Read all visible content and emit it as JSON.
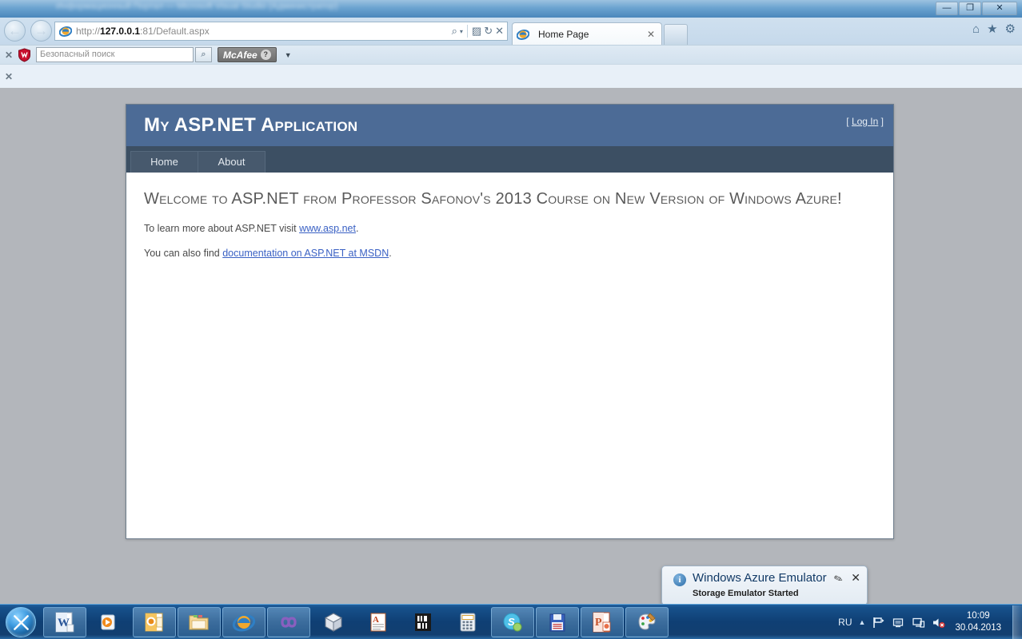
{
  "desktop": {
    "blurred_window_title": "Информационный Портал — Microsoft Visual Studio (Администратор)"
  },
  "window_controls": {
    "minimize": "—",
    "restore": "❐",
    "close": "✕"
  },
  "browser": {
    "back_label": "←",
    "forward_label": "→",
    "address": {
      "scheme": "http://",
      "host": "127.0.0.1",
      "rest": ":81/Default.aspx",
      "full": "http://127.0.0.1:81/Default.aspx"
    },
    "address_icons": {
      "search": "⌕",
      "dropdown": "▾",
      "compatibility": "▨",
      "refresh": "↻",
      "stop": "✕"
    },
    "tabs": [
      {
        "title": "Home Page",
        "close": "✕",
        "active": true
      }
    ],
    "new_tab_label": "",
    "command_icons": {
      "home": "⌂",
      "favorites": "★",
      "tools": "⚙"
    }
  },
  "mcafee_toolbar": {
    "close_label": "✕",
    "search_placeholder": "Безопасный поиск",
    "search_value": "",
    "search_button": "⌕",
    "brand": "McAfee",
    "help_label": "?",
    "caret": "▼"
  },
  "second_toolbar": {
    "close_label": "✕"
  },
  "page": {
    "site_title": "My ASP.NET Application",
    "login": {
      "prefix": "[ ",
      "link": "Log In",
      "suffix": " ]"
    },
    "nav_tabs": [
      {
        "label": "Home",
        "active": true
      },
      {
        "label": "About",
        "active": false
      }
    ],
    "heading": "Welcome to ASP.NET from Professor Safonov's 2013 Course on New Version of Windows Azure!",
    "paragraph1": {
      "before": "To learn more about ASP.NET visit ",
      "link": "www.asp.net",
      "after": "."
    },
    "paragraph2": {
      "before": "You can also find ",
      "link": "documentation on ASP.NET at MSDN",
      "after": "."
    }
  },
  "notification": {
    "info_icon": "i",
    "title": "Windows Azure Emulator",
    "subtitle": "Storage Emulator Started",
    "pin_icon": "✎",
    "close_icon": "✕"
  },
  "taskbar": {
    "start_label": "Start",
    "items": [
      {
        "name": "word",
        "label": "W"
      },
      {
        "name": "media-player",
        "label": "▶"
      },
      {
        "name": "outlook",
        "label": "O"
      },
      {
        "name": "explorer",
        "label": ""
      },
      {
        "name": "internet-explorer",
        "label": "e"
      },
      {
        "name": "visual-studio",
        "label": "∞"
      },
      {
        "name": "cube-app",
        "label": ""
      },
      {
        "name": "document-app",
        "label": "A"
      },
      {
        "name": "barcode-app",
        "label": ""
      },
      {
        "name": "calculator",
        "label": "0"
      },
      {
        "name": "skype",
        "label": "S"
      },
      {
        "name": "save-app",
        "label": ""
      },
      {
        "name": "powerpoint",
        "label": "P"
      },
      {
        "name": "paint",
        "label": ""
      }
    ],
    "tray": {
      "language": "RU",
      "caret": "▲",
      "icons": [
        "flag-icon",
        "network-icon",
        "display-icon",
        "speaker-muted-icon"
      ],
      "time": "10:09",
      "date": "30.04.2013"
    }
  },
  "colors": {
    "page_header_blue": "#4c6b96",
    "nav_bar_navy": "#3c4f63",
    "link_blue": "#3a61c4",
    "taskbar_blue": "#0f3f74",
    "viewport_grey": "#b3b6bb"
  }
}
